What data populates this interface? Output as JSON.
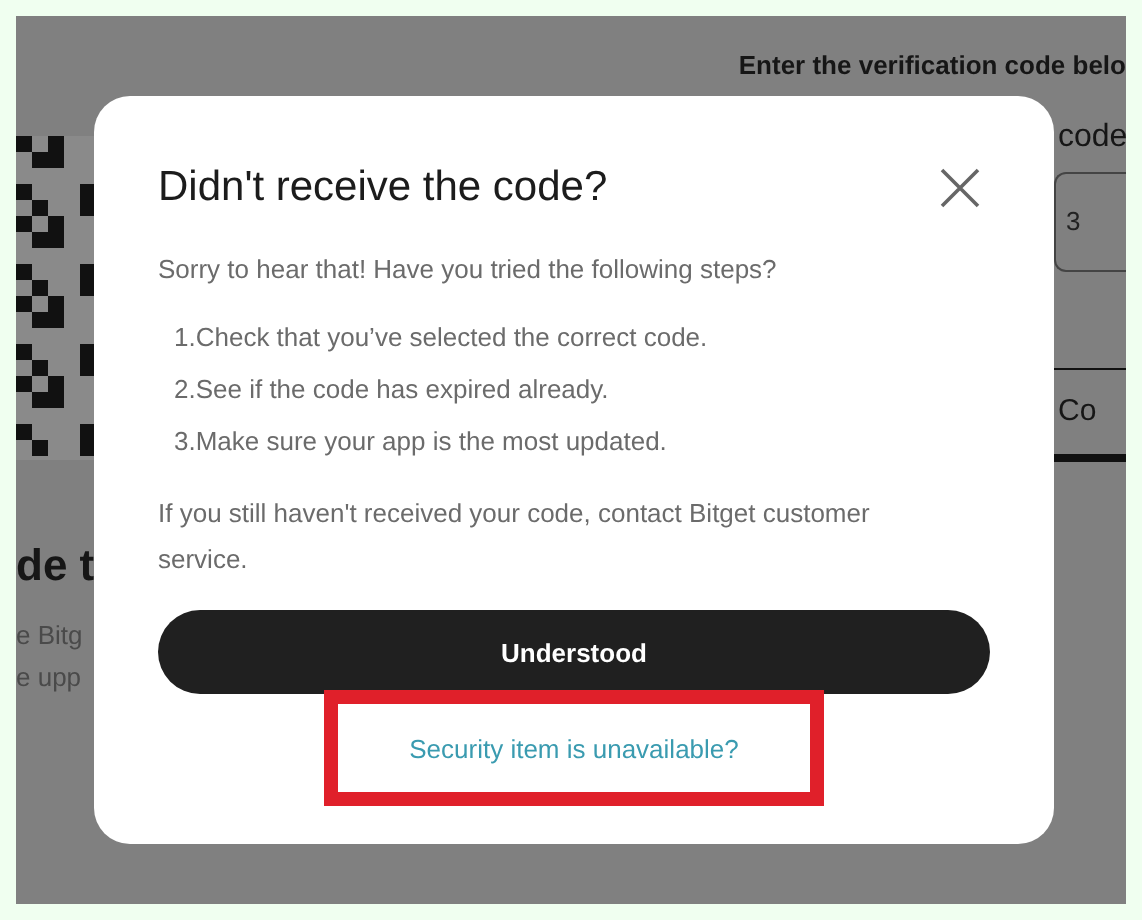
{
  "background_page": {
    "instruction": "Enter the verification code belo",
    "field_label": "code",
    "field_value": "3",
    "tab_label": "Co",
    "heading": "de t",
    "lines": [
      "e Bitg",
      "e upp"
    ]
  },
  "dialog": {
    "title": "Didn't receive the code?",
    "intro": "Sorry to hear that! Have you tried the following steps?",
    "steps": [
      "1.Check that you’ve selected the correct code.",
      "2.See if the code has expired already.",
      "3.Make sure your app is the most updated."
    ],
    "note": "If you still haven't received your code, contact Bitget customer service.",
    "button": "Understood",
    "link": {
      "label": "Security item is unavailable?",
      "highlighted": true
    }
  }
}
